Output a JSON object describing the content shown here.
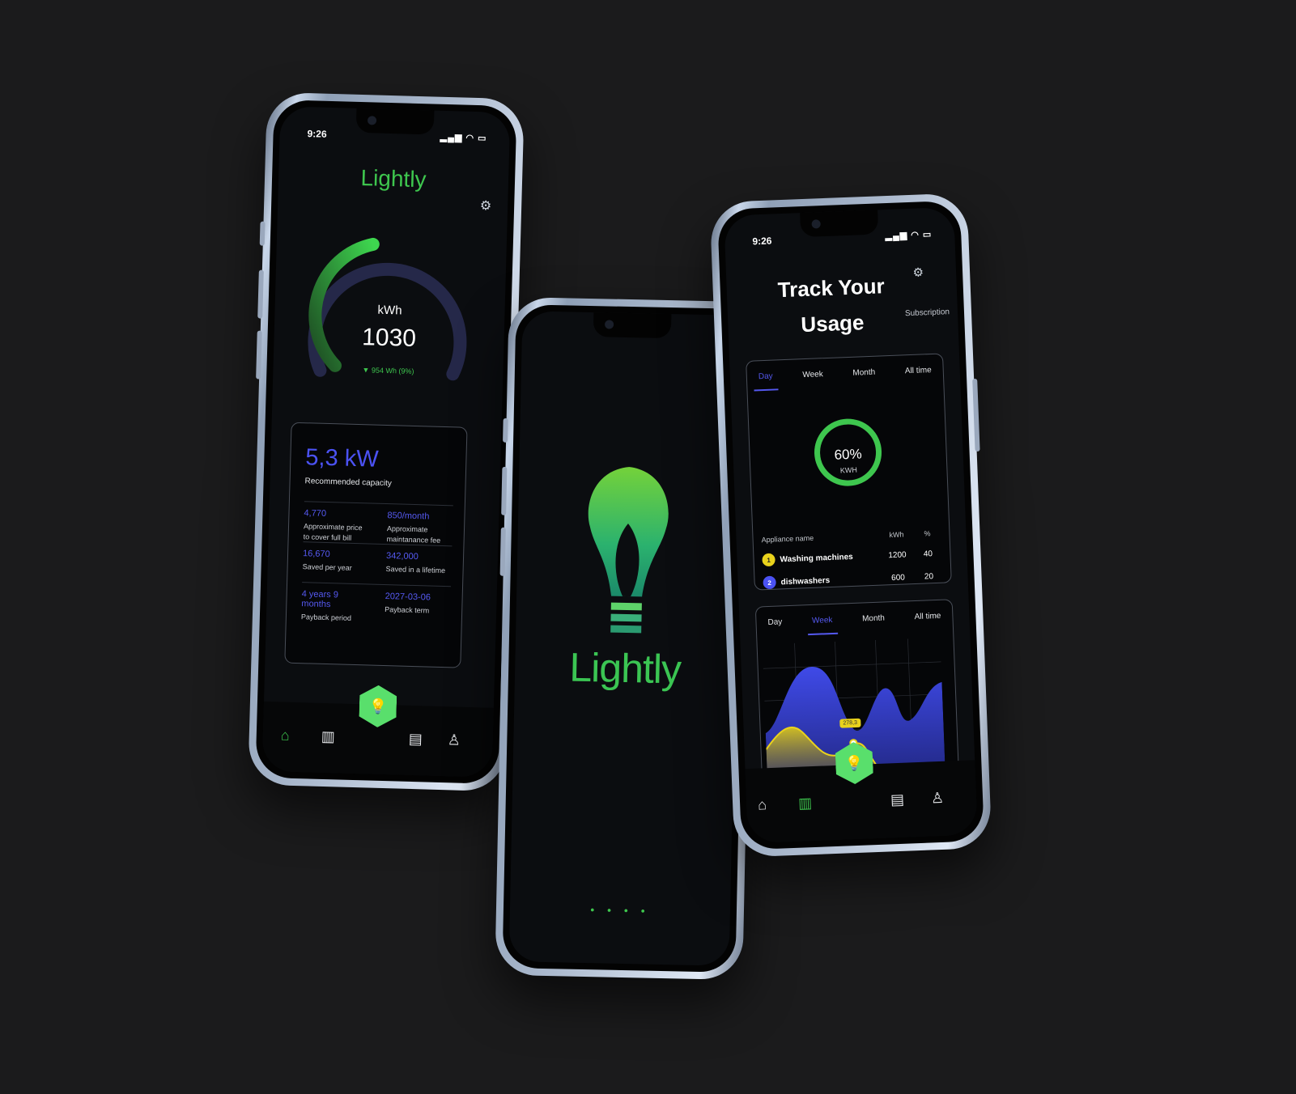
{
  "left_phone": {
    "time": "9:26",
    "brand": "Lightly",
    "gauge": {
      "unit": "kWh",
      "value": "1030",
      "delta": "954 Wh (9%)",
      "fill_fraction": 0.45
    },
    "capacity_card": {
      "headline": "5,3 kW",
      "headline_label": "Recommended capacity",
      "rows": [
        [
          {
            "value": "4,770",
            "label": "Approximate price to cover full bill"
          },
          {
            "value": "850/month",
            "label": "Approximate maintanance fee"
          }
        ],
        [
          {
            "value": "16,670",
            "label": "Saved per year"
          },
          {
            "value": "342,000",
            "label": "Saved in a lifetime"
          }
        ],
        [
          {
            "value": "4 years 9 months",
            "label": "Payback period"
          },
          {
            "value": "2027-03-06",
            "label": "Payback term"
          }
        ]
      ]
    }
  },
  "middle_phone": {
    "brand": "Lightly",
    "loader": "• • • •"
  },
  "right_phone": {
    "time": "9:26",
    "title": "Track Your Usage",
    "subscription_link": "Subscription",
    "usage_tabs": [
      "Day",
      "Week",
      "Month",
      "All time"
    ],
    "usage_active_tab": "Day",
    "ring": {
      "percent": "60%",
      "unit": "KWH",
      "fraction": 0.6
    },
    "table": {
      "headers": {
        "name": "Appliance name",
        "kwh": "kWh",
        "pct": "%"
      },
      "rows": [
        {
          "rank": "1",
          "name": "Washing machines",
          "kwh": "1200",
          "pct": "40"
        },
        {
          "rank": "2",
          "name": "dishwashers",
          "kwh": "600",
          "pct": "20"
        }
      ]
    },
    "chart_tabs": [
      "Day",
      "Week",
      "Month",
      "All time"
    ],
    "chart_active_tab": "Week",
    "chart_tag": "278,3"
  },
  "colors": {
    "accent_green": "#3ec64e",
    "accent_blue": "#4b52f3",
    "accent_yellow": "#e9d21c",
    "background": "#1b1b1c"
  },
  "icons": {
    "settings": "gear-icon",
    "home": "home-icon",
    "stats": "bar-chart-icon",
    "document": "document-icon",
    "profile": "user-icon",
    "bulb": "bulb-icon"
  }
}
